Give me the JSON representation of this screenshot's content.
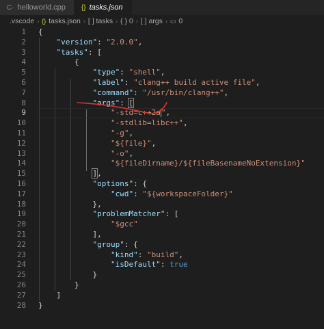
{
  "tabs": [
    {
      "label": "helloworld.cpp",
      "icon": "cpp-file-icon",
      "active": false
    },
    {
      "label": "tasks.json",
      "icon": "json-file-icon",
      "active": true
    }
  ],
  "breadcrumb": {
    "folder": ".vscode",
    "file": "tasks.json",
    "items": [
      "[ ] tasks",
      "{ } 0",
      "[ ] args",
      "0"
    ]
  },
  "editor": {
    "current_line": 9,
    "lines": [
      {
        "n": "1"
      },
      {
        "n": "2"
      },
      {
        "n": "3"
      },
      {
        "n": "4"
      },
      {
        "n": "5"
      },
      {
        "n": "6"
      },
      {
        "n": "7"
      },
      {
        "n": "8"
      },
      {
        "n": "9"
      },
      {
        "n": "10"
      },
      {
        "n": "11"
      },
      {
        "n": "12"
      },
      {
        "n": "13"
      },
      {
        "n": "14"
      },
      {
        "n": "15"
      },
      {
        "n": "16"
      },
      {
        "n": "17"
      },
      {
        "n": "18"
      },
      {
        "n": "19"
      },
      {
        "n": "20"
      },
      {
        "n": "21"
      },
      {
        "n": "22"
      },
      {
        "n": "23"
      },
      {
        "n": "24"
      },
      {
        "n": "25"
      },
      {
        "n": "26"
      },
      {
        "n": "27"
      },
      {
        "n": "28"
      }
    ],
    "tokens": {
      "version_key": "\"version\"",
      "version_val": "\"2.0.0\"",
      "tasks_key": "\"tasks\"",
      "type_key": "\"type\"",
      "type_val": "\"shell\"",
      "label_key": "\"label\"",
      "label_val": "\"clang++ build active file\"",
      "command_key": "\"command\"",
      "command_val": "\"/usr/bin/clang++\"",
      "args_key": "\"args\"",
      "arg1_a": "\"-std=c++2a",
      "arg1_b": "\"",
      "arg2": "\"-stdlib=libc++\"",
      "arg3": "\"-g\"",
      "arg4": "\"${file}\"",
      "arg5": "\"-o\"",
      "arg6": "\"${fileDirname}/${fileBasenameNoExtension}\"",
      "options_key": "\"options\"",
      "cwd_key": "\"cwd\"",
      "cwd_val": "\"${workspaceFolder}\"",
      "pm_key": "\"problemMatcher\"",
      "pm_val": "\"$gcc\"",
      "group_key": "\"group\"",
      "kind_key": "\"kind\"",
      "kind_val": "\"build\"",
      "isdefault_key": "\"isDefault\"",
      "isdefault_val": "true"
    }
  },
  "colors": {
    "background": "#1e1e1e",
    "key": "#9cdcfe",
    "string": "#ce9178",
    "keyword": "#569cd6",
    "annotation": "#e0322e"
  }
}
